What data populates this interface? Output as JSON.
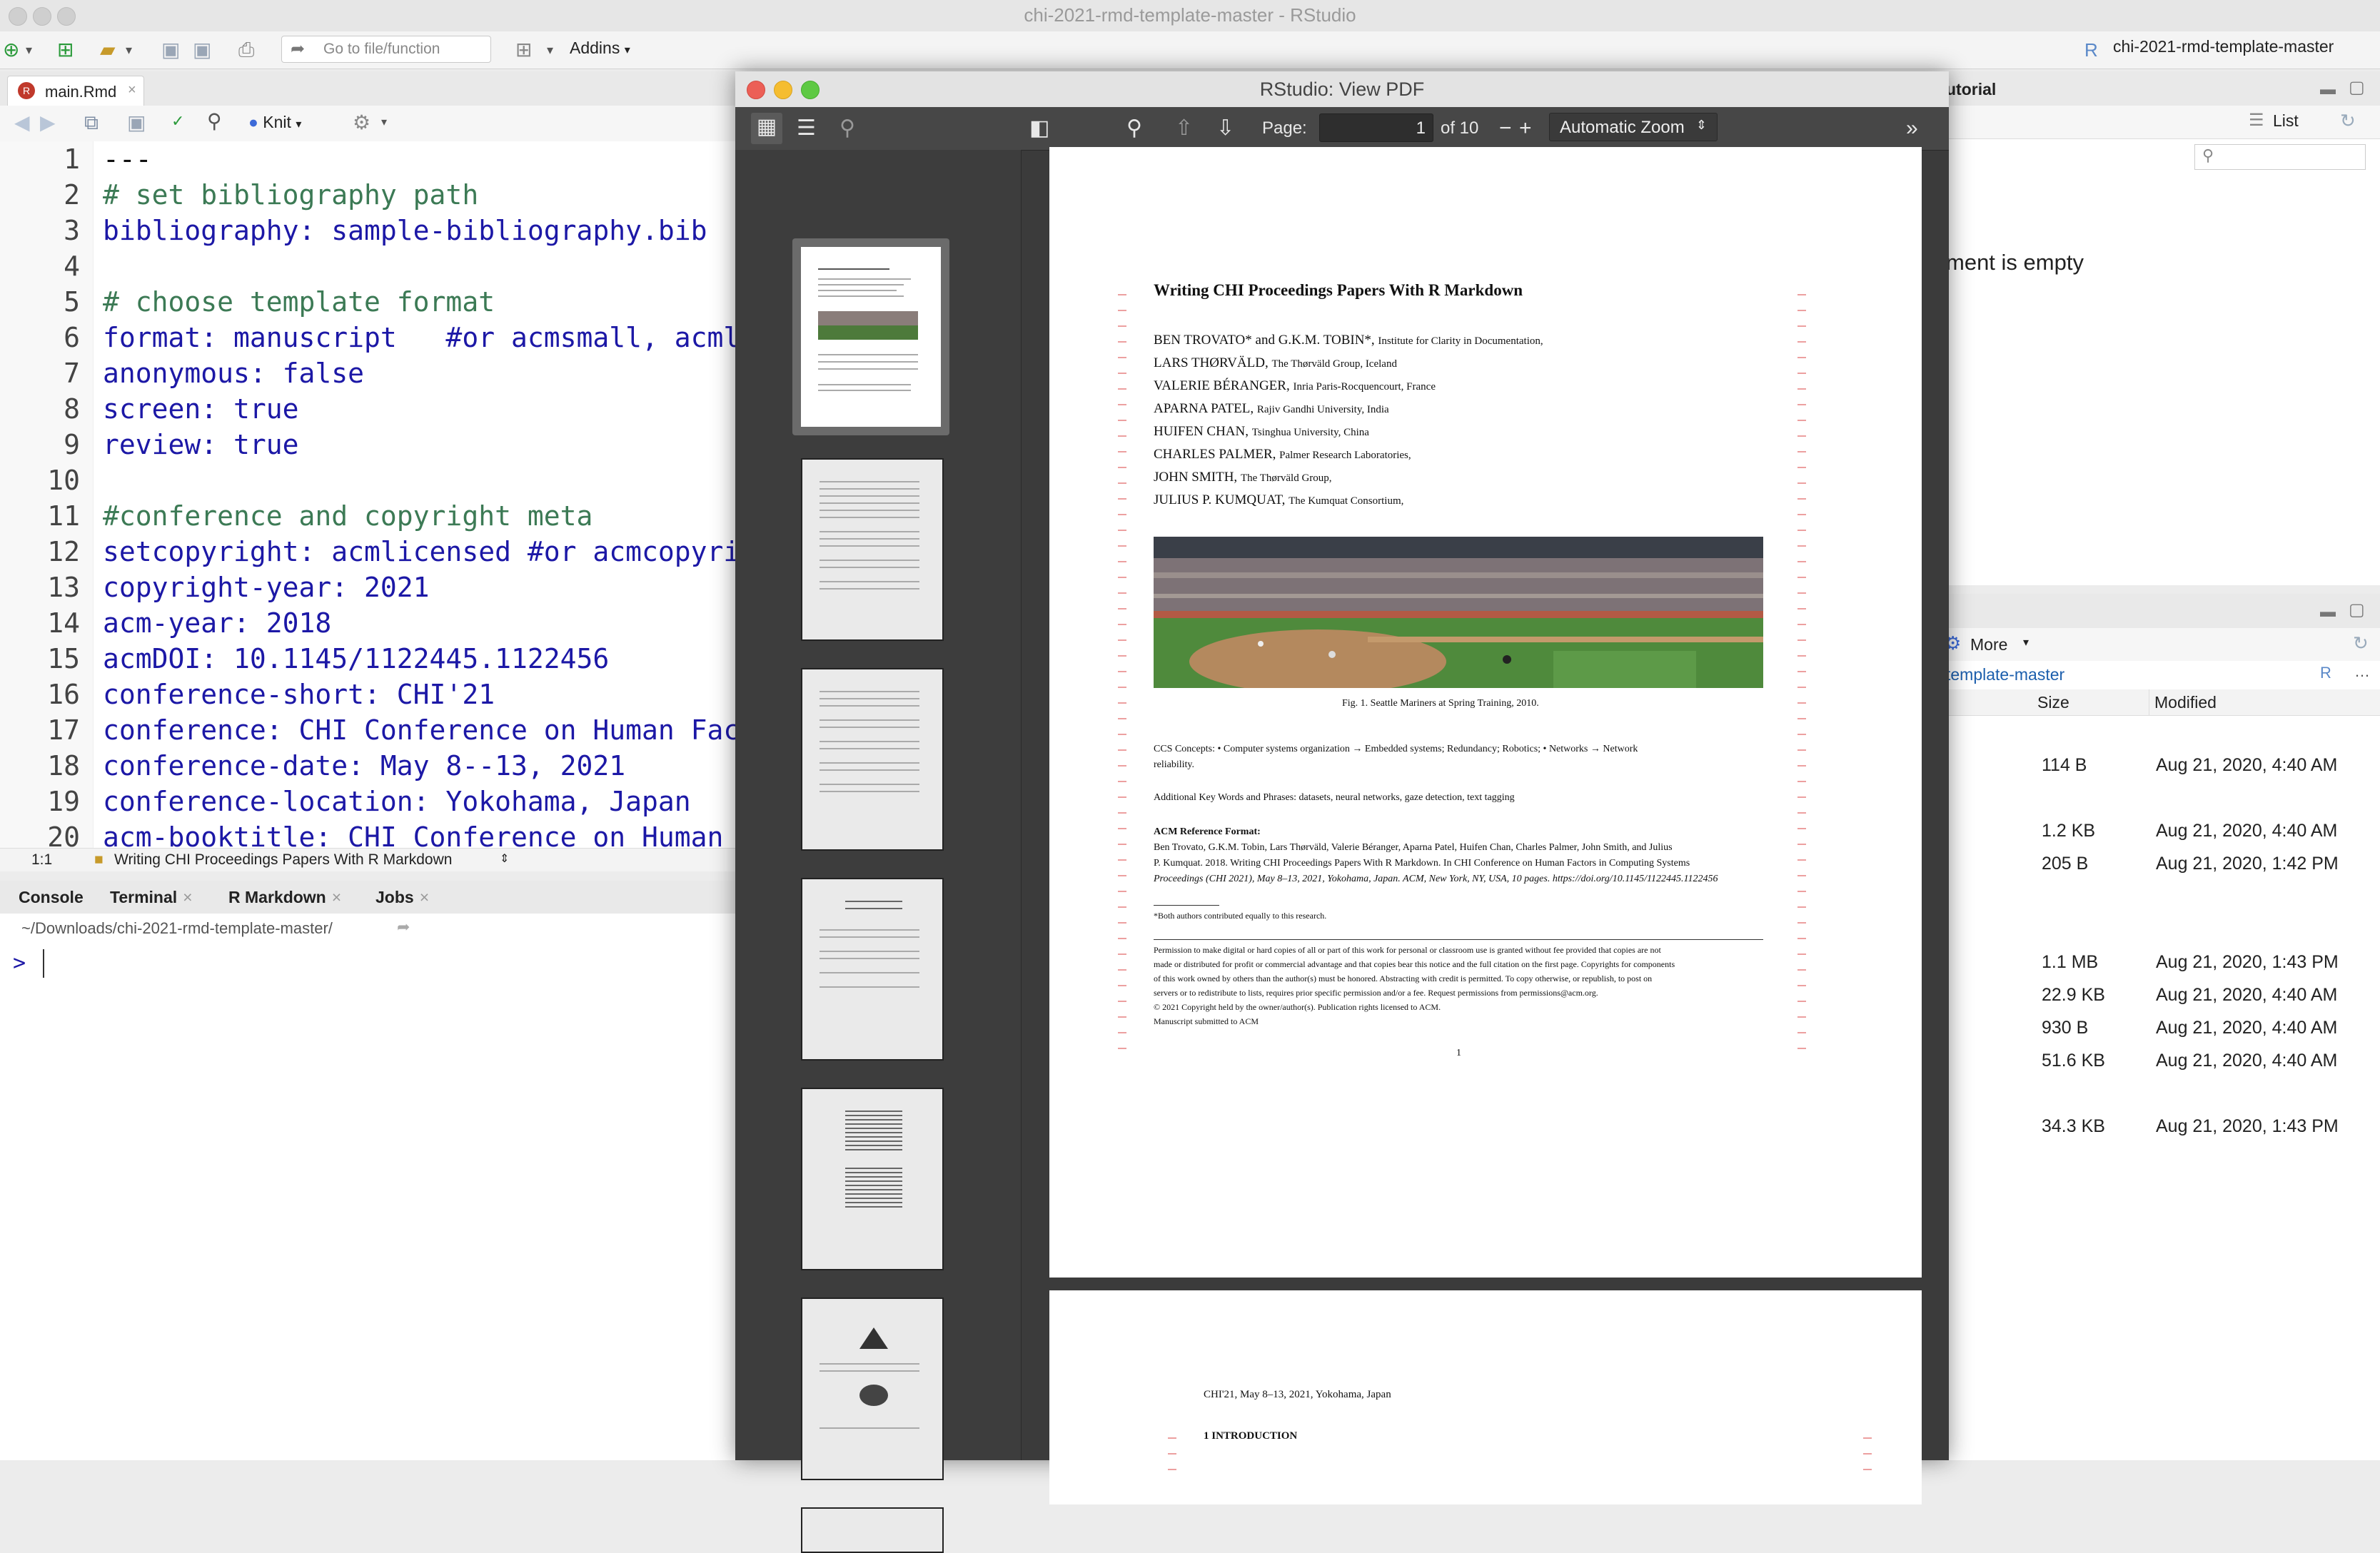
{
  "window": {
    "title": "chi-2021-rmd-template-master - RStudio"
  },
  "toolbar": {
    "goto_placeholder": "Go to file/function",
    "addins": "Addins",
    "project": "chi-2021-rmd-template-master"
  },
  "editor": {
    "tab": "main.Rmd",
    "knit": "Knit",
    "lines": [
      {
        "n": "1",
        "t": "---"
      },
      {
        "n": "2",
        "t": "# set bibliography path"
      },
      {
        "n": "3",
        "t": "bibliography: sample-bibliography.bib"
      },
      {
        "n": "4",
        "t": ""
      },
      {
        "n": "5",
        "t": "# choose template format"
      },
      {
        "n": "6",
        "t": "format: manuscript   #or acmsmall, acmlarge"
      },
      {
        "n": "7",
        "t": "anonymous: false"
      },
      {
        "n": "8",
        "t": "screen: true"
      },
      {
        "n": "9",
        "t": "review: true"
      },
      {
        "n": "10",
        "t": ""
      },
      {
        "n": "11",
        "t": "#conference and copyright meta"
      },
      {
        "n": "12",
        "t": "setcopyright: acmlicensed #or acmcopyright,"
      },
      {
        "n": "13",
        "t": "copyright-year: 2021"
      },
      {
        "n": "14",
        "t": "acm-year: 2018"
      },
      {
        "n": "15",
        "t": "acmDOI: 10.1145/1122445.1122456"
      },
      {
        "n": "16",
        "t": "conference-short: CHI'21"
      },
      {
        "n": "17",
        "t": "conference: CHI Conference on Human Factors"
      },
      {
        "n": "18",
        "t": "conference-date: May 8--13, 2021"
      },
      {
        "n": "19",
        "t": "conference-location: Yokohama, Japan"
      },
      {
        "n": "20",
        "t": "acm-booktitle: CHI Conference on Human Fact"
      }
    ],
    "status_pos": "1:1",
    "status_section": "Writing CHI Proceedings Papers With R Markdown"
  },
  "console": {
    "tabs": [
      "Console",
      "Terminal",
      "R Markdown",
      "Jobs"
    ],
    "path": "~/Downloads/chi-2021-rmd-template-master/",
    "prompt": ">"
  },
  "right_top": {
    "tab_fragment": "utorial",
    "list_label": "List",
    "empty_text": "ment is empty"
  },
  "files": {
    "more": "More",
    "path": "template-master",
    "col_size": "Size",
    "col_modified": "Modified",
    "rows": [
      {
        "size": "114 B",
        "mod": "Aug 21, 2020, 4:40 AM"
      },
      {
        "size": "1.2 KB",
        "mod": "Aug 21, 2020, 4:40 AM"
      },
      {
        "size": "205 B",
        "mod": "Aug 21, 2020, 1:42 PM"
      },
      {
        "size": "1.1 MB",
        "mod": "Aug 21, 2020, 1:43 PM"
      },
      {
        "size": "22.9 KB",
        "mod": "Aug 21, 2020, 4:40 AM"
      },
      {
        "size": "930 B",
        "mod": "Aug 21, 2020, 4:40 AM"
      },
      {
        "size": "51.6 KB",
        "mod": "Aug 21, 2020, 4:40 AM"
      },
      {
        "size": "34.3 KB",
        "mod": "Aug 21, 2020, 1:43 PM"
      }
    ]
  },
  "pdf": {
    "title": "RStudio: View PDF",
    "page_label": "Page:",
    "page_value": "1",
    "page_total": "of 10",
    "zoom": "Automatic Zoom",
    "paper_title": "Writing CHI Proceedings Papers With R Markdown",
    "authors": [
      {
        "name": "BEN TROVATO* and G.K.M. TOBIN*,",
        "aff": "Institute for Clarity in Documentation,"
      },
      {
        "name": "LARS THØRVÄLD,",
        "aff": "The Thørväld Group, Iceland"
      },
      {
        "name": "VALERIE BÉRANGER,",
        "aff": "Inria Paris-Rocquencourt, France"
      },
      {
        "name": "APARNA PATEL,",
        "aff": "Rajiv Gandhi University, India"
      },
      {
        "name": "HUIFEN CHAN,",
        "aff": "Tsinghua University, China"
      },
      {
        "name": "CHARLES PALMER,",
        "aff": "Palmer Research Laboratories,"
      },
      {
        "name": "JOHN SMITH,",
        "aff": "The Thørväld Group,"
      },
      {
        "name": "JULIUS P. KUMQUAT,",
        "aff": "The Kumquat Consortium,"
      }
    ],
    "fig_caption": "Fig. 1.  Seattle Mariners at Spring Training, 2010.",
    "ccs": "CCS Concepts: • Computer systems organization → Embedded systems; Redundancy; Robotics; • Networks → Network",
    "ccs2": "reliability.",
    "keywords": "Additional Key Words and Phrases: datasets, neural networks, gaze detection, text tagging",
    "ref_heading": "ACM Reference Format:",
    "ref1": "Ben Trovato, G.K.M. Tobin, Lars Thørväld, Valerie Béranger, Aparna Patel, Huifen Chan, Charles Palmer, John Smith, and Julius",
    "ref2": "P. Kumquat. 2018. Writing CHI Proceedings Papers With R Markdown. In CHI Conference on Human Factors in Computing Systems",
    "ref3": "Proceedings (CHI 2021), May 8–13, 2021, Yokohama, Japan. ACM, New York, NY, USA, 10 pages. https://doi.org/10.1145/1122445.1122456",
    "footnote": "*Both authors contributed equally to this research.",
    "perm1": "Permission to make digital or hard copies of all or part of this work for personal or classroom use is granted without fee provided that copies are not",
    "perm2": "made or distributed for profit or commercial advantage and that copies bear this notice and the full citation on the first page. Copyrights for components",
    "perm3": "of this work owned by others than the author(s) must be honored. Abstracting with credit is permitted. To copy otherwise, or republish, to post on",
    "perm4": "servers or to redistribute to lists, requires prior specific permission and/or a fee. Request permissions from permissions@acm.org.",
    "perm5": "© 2021 Copyright held by the owner/author(s). Publication rights licensed to ACM.",
    "perm6": "Manuscript submitted to ACM",
    "page_num": "1",
    "page2_header": "CHI'21, May 8–13, 2021, Yokohama, Japan",
    "page2_section": "1    INTRODUCTION"
  },
  "colors": {
    "accent": "#1c18a6",
    "comment": "#3c7a55",
    "pdf_dark": "#3b3b3b"
  }
}
